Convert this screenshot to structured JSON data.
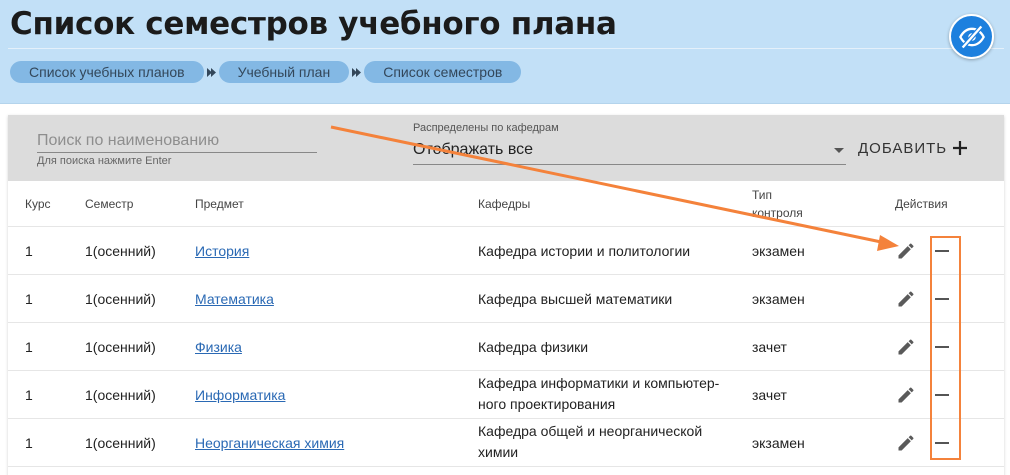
{
  "header": {
    "title": "Список семестров учебного плана",
    "breadcrumbs": [
      "Список учебных планов",
      "Учебный план",
      "Список семестров"
    ]
  },
  "toolbar": {
    "search_placeholder": "Поиск по наименованию",
    "search_hint": "Для поиска нажмите Enter",
    "filter_label": "Распределены по кафедрам",
    "filter_value": "Отображать все",
    "add_label": "ДОБАВИТЬ"
  },
  "table": {
    "headers": {
      "course": "Курс",
      "semester": "Семестр",
      "subject": "Предмет",
      "departments": "Кафедры",
      "control_type_line1": "Тип",
      "control_type_line2": "контроля",
      "actions": "Действия"
    },
    "rows": [
      {
        "course": "1",
        "semester": "1(осенний)",
        "subject": "История",
        "dept_line1": "Кафедра истории и политологии",
        "dept_line2": "",
        "control": "экзамен"
      },
      {
        "course": "1",
        "semester": "1(осенний)",
        "subject": "Математика",
        "dept_line1": "Кафедра высшей математики",
        "dept_line2": "",
        "control": "экзамен"
      },
      {
        "course": "1",
        "semester": "1(осенний)",
        "subject": "Физика",
        "dept_line1": "Кафедра физики",
        "dept_line2": "",
        "control": "зачет"
      },
      {
        "course": "1",
        "semester": "1(осенний)",
        "subject": "Информатика",
        "dept_line1": "Кафедра информатики и компьютер-",
        "dept_line2": "ного проектирования",
        "control": "зачет"
      },
      {
        "course": "1",
        "semester": "1(осенний)",
        "subject": "Неорганическая химия",
        "dept_line1": "Кафедра общей и неорганической",
        "dept_line2": "химии",
        "control": "экзамен"
      }
    ]
  },
  "colors": {
    "header_bg": "#c2e0f7",
    "toolbar_bg": "#dcdcdc",
    "breadcrumb_bg": "#83b8e4",
    "accent_blue": "#1d80de",
    "link": "#2a69b4",
    "annotation": "#f4823b"
  },
  "icons": {
    "visibility_toggle": "eye-off-icon",
    "breadcrumb_separator": "chevron-right-icon",
    "add": "plus-icon",
    "edit": "pencil-icon",
    "remove": "minus-icon"
  }
}
